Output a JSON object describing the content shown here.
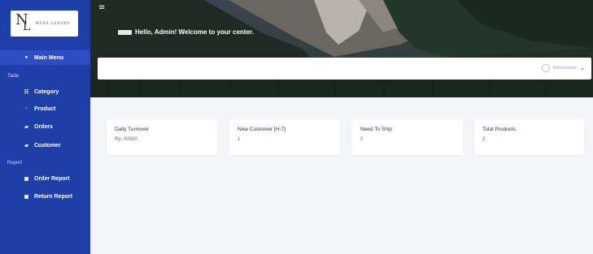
{
  "sidebar": {
    "logo": {
      "text": "NEXA LUXURY",
      "mark_n": "N",
      "mark_l": "L"
    },
    "items": [
      {
        "label": "Main Menu",
        "icon": "home-icon",
        "glyph": "♠"
      },
      {
        "label": "Category",
        "icon": "category-icon",
        "glyph": "☷"
      },
      {
        "label": "Product",
        "icon": "product-icon",
        "glyph": "◌"
      },
      {
        "label": "Orders",
        "icon": "orders-icon",
        "glyph": "▰"
      },
      {
        "label": "Customer",
        "icon": "customer-icon",
        "glyph": "▰"
      },
      {
        "label": "Order Report",
        "icon": "report-icon",
        "glyph": "▣"
      },
      {
        "label": "Return Report",
        "icon": "report-icon",
        "glyph": "▣"
      }
    ],
    "sections": [
      "Table",
      "Report"
    ]
  },
  "header": {
    "greeting": "Hello, Admin! Welcome to your center.",
    "menu_glyph": "≡"
  },
  "topbar": {
    "profile_name": "Administrator",
    "caret": "⌄"
  },
  "cards": [
    {
      "label": "Daily Turnover",
      "value": "Rp. 00000"
    },
    {
      "label": "New Customer [H-7]",
      "value": "1"
    },
    {
      "label": "Need To Ship",
      "value": "0"
    },
    {
      "label": "Total Products",
      "value": "2"
    }
  ],
  "colors": {
    "sidebar": "#1f3fa8",
    "active": "#2b4fc2",
    "background": "#f3f5f9"
  }
}
